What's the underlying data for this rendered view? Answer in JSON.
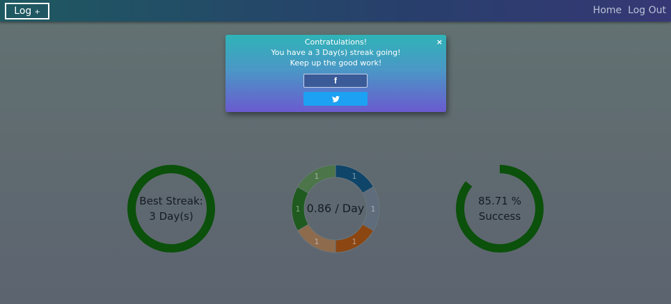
{
  "navbar": {
    "brand_label": "Log",
    "brand_plus": "+",
    "links": [
      "Home",
      "Log Out"
    ]
  },
  "popup": {
    "lines": [
      "Contratulations!",
      "You have a 3 Day(s) streak going!",
      "Keep up the good work!"
    ],
    "close_glyph": "×",
    "facebook_glyph": "f"
  },
  "stats": {
    "best_streak": {
      "line1": "Best Streak:",
      "line2": "3 Day(s)",
      "ring_color": "#0b500b"
    },
    "rate": {
      "text": "0.86 / Day",
      "segments": [
        {
          "value": 1,
          "color": "#0e4569"
        },
        {
          "value": 1,
          "color": "#5f6c7b"
        },
        {
          "value": 1,
          "color": "#8b4611"
        },
        {
          "value": 1,
          "color": "#8e6b4d"
        },
        {
          "value": 1,
          "color": "#1f5a1f"
        },
        {
          "value": 1,
          "color": "#4c7549"
        }
      ],
      "segment_labels": [
        "1",
        "1",
        "1",
        "1",
        "1",
        "1"
      ]
    },
    "success": {
      "line1": "85.71 %",
      "line2": "Success",
      "fraction": 0.8571,
      "ring_color": "#0b500b"
    }
  }
}
